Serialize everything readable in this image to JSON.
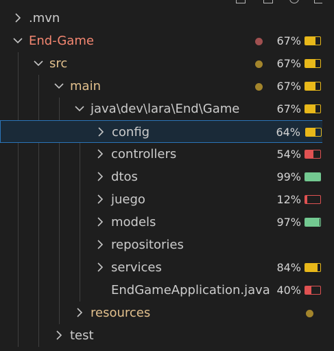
{
  "colors": {
    "background": "#1e1e1e",
    "text_default": "#cccccc",
    "text_modified": "#e2c08d",
    "text_error": "#f48771",
    "dot_modified": "#a3852c",
    "dot_error": "#a05050",
    "coverage_yellow": "#e8b81a",
    "coverage_green": "#73c991",
    "coverage_red": "#e05252",
    "selection_border": "#2b74b8",
    "java_icon": "#e35a46"
  },
  "tree": [
    {
      "label": ".mvn",
      "depth": 0,
      "expanded": false,
      "icon": "chevron-right-icon",
      "color": "text_default",
      "dot": null,
      "coverage": null
    },
    {
      "label": "End-Game",
      "depth": 0,
      "expanded": true,
      "icon": "chevron-down-icon",
      "color": "text_error",
      "dot": "dot_error",
      "coverage": {
        "pct": "67%",
        "value": 0.67,
        "color": "coverage_yellow"
      }
    },
    {
      "label": "src",
      "depth": 1,
      "expanded": true,
      "icon": "chevron-down-icon",
      "color": "text_modified",
      "dot": "dot_modified",
      "coverage": {
        "pct": "67%",
        "value": 0.67,
        "color": "coverage_yellow"
      }
    },
    {
      "label": "main",
      "depth": 2,
      "expanded": true,
      "icon": "chevron-down-icon",
      "color": "text_modified",
      "dot": "dot_modified",
      "coverage": {
        "pct": "67%",
        "value": 0.67,
        "color": "coverage_yellow"
      }
    },
    {
      "label": "java\\dev\\lara\\End\\Game",
      "depth": 3,
      "expanded": true,
      "icon": "chevron-down-icon",
      "color": "text_default",
      "dot": null,
      "coverage": {
        "pct": "67%",
        "value": 0.67,
        "color": "coverage_yellow"
      }
    },
    {
      "label": "config",
      "depth": 4,
      "expanded": false,
      "icon": "chevron-right-icon",
      "color": "text_default",
      "dot": null,
      "selected": true,
      "coverage": {
        "pct": "64%",
        "value": 0.64,
        "color": "coverage_yellow"
      }
    },
    {
      "label": "controllers",
      "depth": 4,
      "expanded": false,
      "icon": "chevron-right-icon",
      "color": "text_default",
      "dot": null,
      "coverage": {
        "pct": "54%",
        "value": 0.54,
        "color": "coverage_red"
      }
    },
    {
      "label": "dtos",
      "depth": 4,
      "expanded": false,
      "icon": "chevron-right-icon",
      "color": "text_default",
      "dot": null,
      "coverage": {
        "pct": "99%",
        "value": 0.99,
        "color": "coverage_green"
      }
    },
    {
      "label": "juego",
      "depth": 4,
      "expanded": false,
      "icon": "chevron-right-icon",
      "color": "text_default",
      "dot": null,
      "coverage": {
        "pct": "12%",
        "value": 0.12,
        "color": "coverage_red"
      }
    },
    {
      "label": "models",
      "depth": 4,
      "expanded": false,
      "icon": "chevron-right-icon",
      "color": "text_default",
      "dot": null,
      "coverage": {
        "pct": "97%",
        "value": 0.97,
        "color": "coverage_green"
      }
    },
    {
      "label": "repositories",
      "depth": 4,
      "expanded": false,
      "icon": "chevron-right-icon",
      "color": "text_default",
      "dot": null,
      "coverage": null
    },
    {
      "label": "services",
      "depth": 4,
      "expanded": false,
      "icon": "chevron-right-icon",
      "color": "text_default",
      "dot": null,
      "coverage": {
        "pct": "84%",
        "value": 0.84,
        "color": "coverage_yellow"
      }
    },
    {
      "label": "EndGameApplication.java",
      "depth": 4,
      "expanded": null,
      "icon": "java-file-icon",
      "file_glyph": "J",
      "color": "text_default",
      "dot": null,
      "coverage": {
        "pct": "40%",
        "value": 0.4,
        "color": "coverage_red"
      }
    },
    {
      "label": "resources",
      "depth": 3,
      "expanded": false,
      "icon": "chevron-right-icon",
      "color": "text_modified",
      "dot": "dot_modified",
      "dot_far": true,
      "coverage": null
    },
    {
      "label": "test",
      "depth": 2,
      "expanded": false,
      "icon": "chevron-right-icon",
      "color": "text_default",
      "dot": null,
      "coverage": null
    }
  ]
}
